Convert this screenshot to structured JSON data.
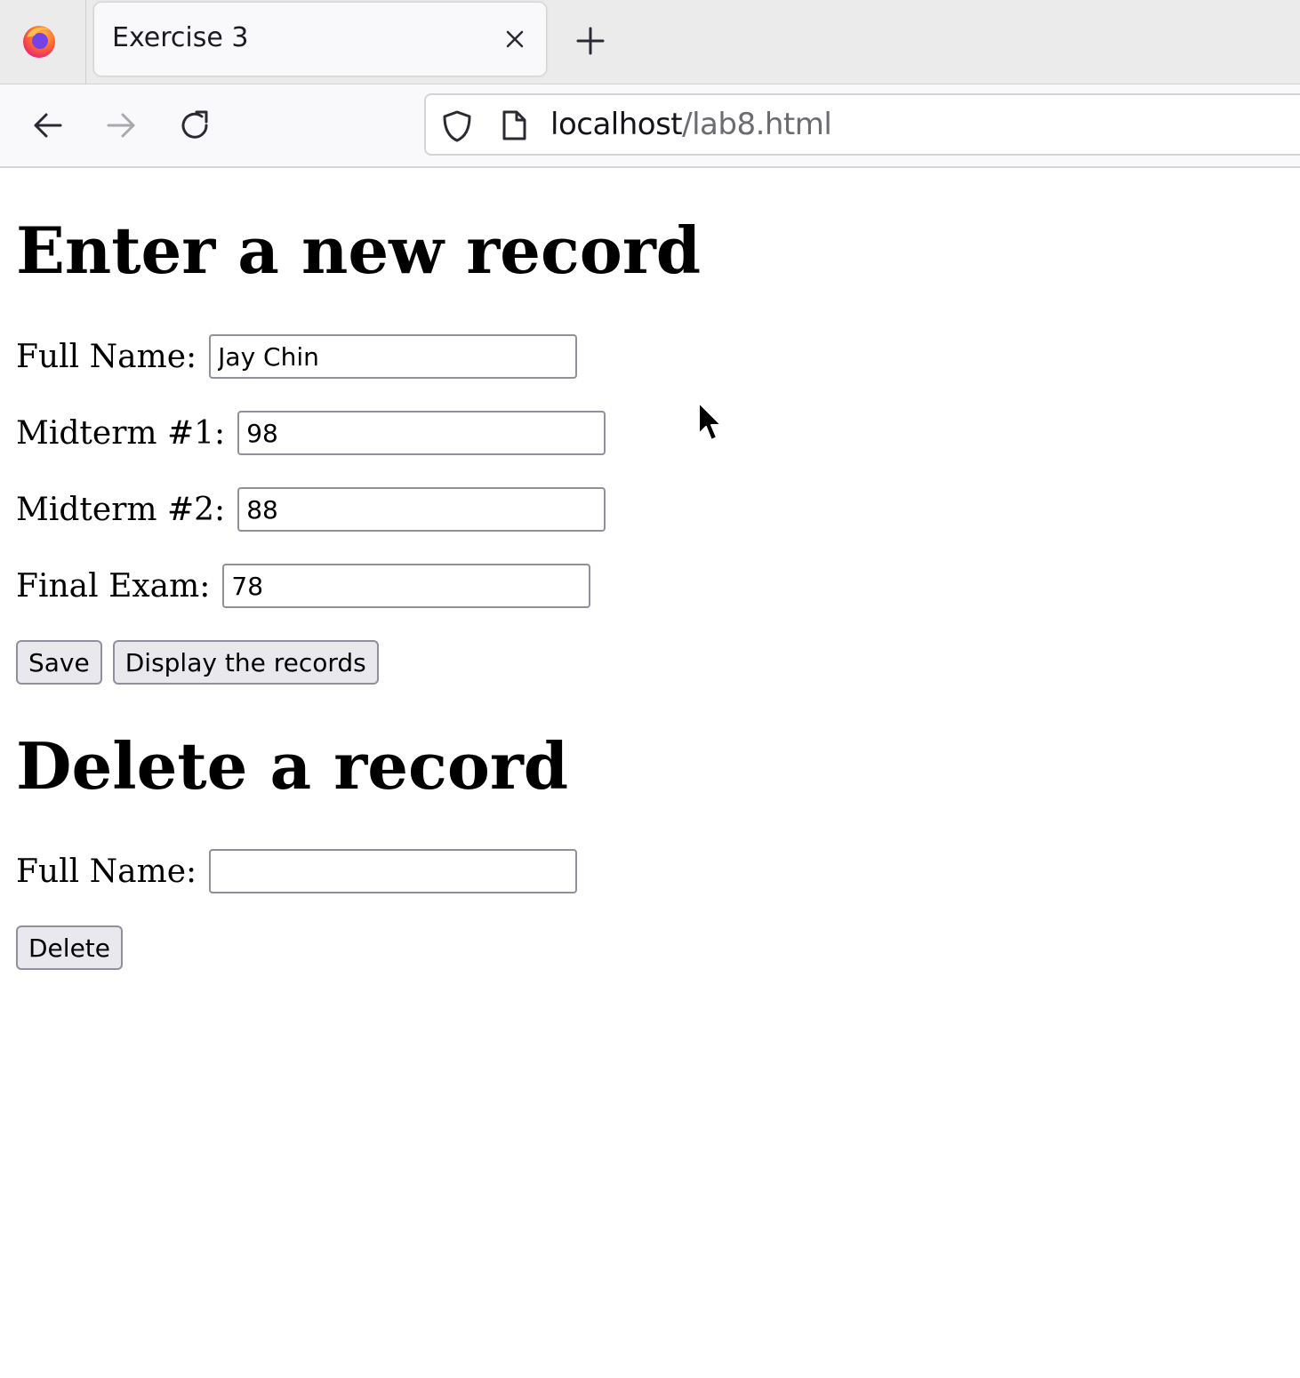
{
  "browser": {
    "tab_title": "Exercise 3",
    "url_host": "localhost",
    "url_path": "/lab8.html",
    "icons": {
      "app": "firefox-icon",
      "tab_close": "close-icon",
      "new_tab": "plus-icon",
      "back": "back-arrow-icon",
      "forward": "forward-arrow-icon",
      "reload": "reload-icon",
      "security": "shield-icon",
      "page": "page-icon"
    }
  },
  "insert_form": {
    "heading": "Enter a new record",
    "full_name_label": "Full Name:",
    "full_name_value": "Jay Chin",
    "midterm1_label": "Midterm #1:",
    "midterm1_value": "98",
    "midterm2_label": "Midterm #2:",
    "midterm2_value": "88",
    "final_label": "Final Exam:",
    "final_value": "78",
    "save_label": "Save",
    "display_label": "Display the records"
  },
  "delete_form": {
    "heading": "Delete a record",
    "full_name_label": "Full Name:",
    "full_name_value": "",
    "delete_label": "Delete"
  }
}
